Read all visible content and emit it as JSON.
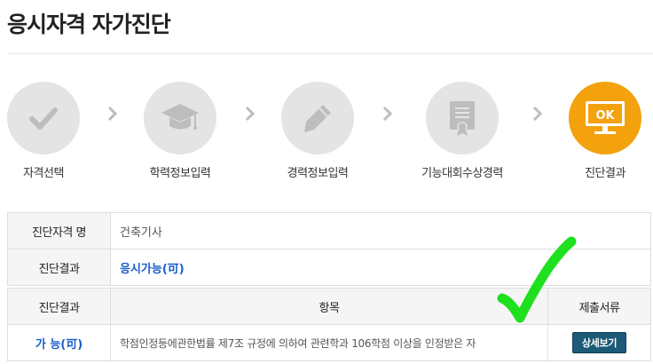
{
  "page": {
    "title": "응시자격 자가진단"
  },
  "steps": [
    {
      "label": "자격선택",
      "icon": "check-icon",
      "active": false
    },
    {
      "label": "학력정보입력",
      "icon": "graduation-cap-icon",
      "active": false
    },
    {
      "label": "경력정보입력",
      "icon": "pencil-icon",
      "active": false
    },
    {
      "label": "기능대회수상경력",
      "icon": "certificate-icon",
      "active": false
    },
    {
      "label": "진단결과",
      "icon": "monitor-ok-icon",
      "active": true,
      "badge": "OK"
    }
  ],
  "colors": {
    "active_step": "#f3a20d",
    "inactive_step": "#e4e4e4",
    "result_link": "#1a5ec9",
    "button": "#1c5a77",
    "handwritten_check": "#1ee01e"
  },
  "summary": {
    "name_label": "진단자격 명",
    "name_value": "건축기사",
    "result_label": "진단결과",
    "result_value": "응시가능(可)"
  },
  "detail": {
    "headers": {
      "result": "진단결과",
      "item": "항목",
      "docs": "제출서류"
    },
    "rows": [
      {
        "result": "가 능(可)",
        "item": "학점인정등에관한법률 제7조 규정에 의하여 관련학과 106학점 이상을 인정받은 자",
        "button": "상세보기"
      }
    ]
  }
}
